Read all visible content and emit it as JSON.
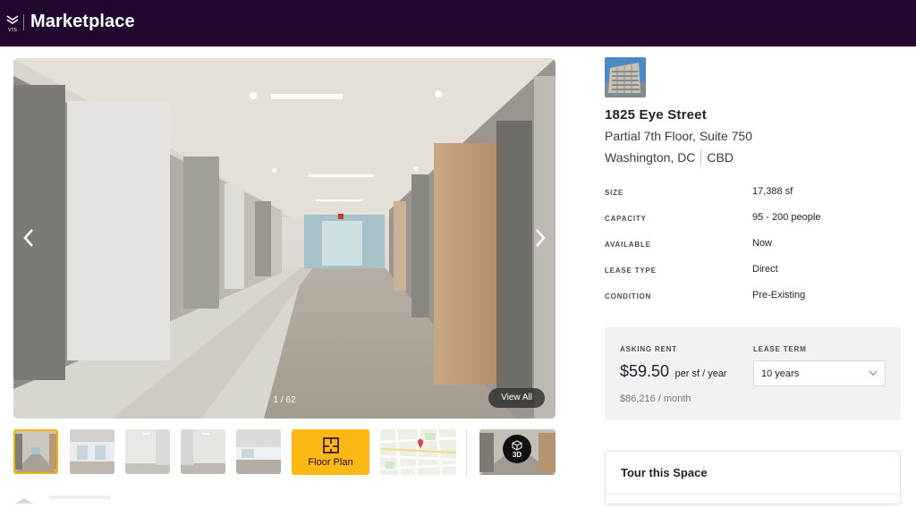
{
  "header": {
    "brand": "Marketplace",
    "logo_text": "VTS",
    "background": "#22082e"
  },
  "gallery": {
    "counter": "1 / 62",
    "view_all_label": "View All",
    "prev_icon": "chevron-left-icon",
    "next_icon": "chevron-right-icon"
  },
  "thumbnails": {
    "floor_plan_label": "Floor Plan",
    "tour_badge": "3D",
    "accent": "#fdb913"
  },
  "listing": {
    "address": "1825 Eye Street",
    "suite": "Partial 7th Floor, Suite 750",
    "city": "Washington, DC",
    "submarket": "CBD",
    "specs": [
      {
        "label": "SIZE",
        "value": "17,388 sf"
      },
      {
        "label": "CAPACITY",
        "value": "95 - 200 people"
      },
      {
        "label": "AVAILABLE",
        "value": "Now"
      },
      {
        "label": "LEASE TYPE",
        "value": "Direct"
      },
      {
        "label": "CONDITION",
        "value": "Pre-Existing"
      }
    ]
  },
  "pricing": {
    "asking_rent_label": "ASKING RENT",
    "rent_amount": "$59.50",
    "rent_unit": "per sf / year",
    "monthly": "$86,216 / month",
    "lease_term_label": "LEASE TERM",
    "lease_term_value": "10 years"
  },
  "tour": {
    "title": "Tour this Space"
  }
}
